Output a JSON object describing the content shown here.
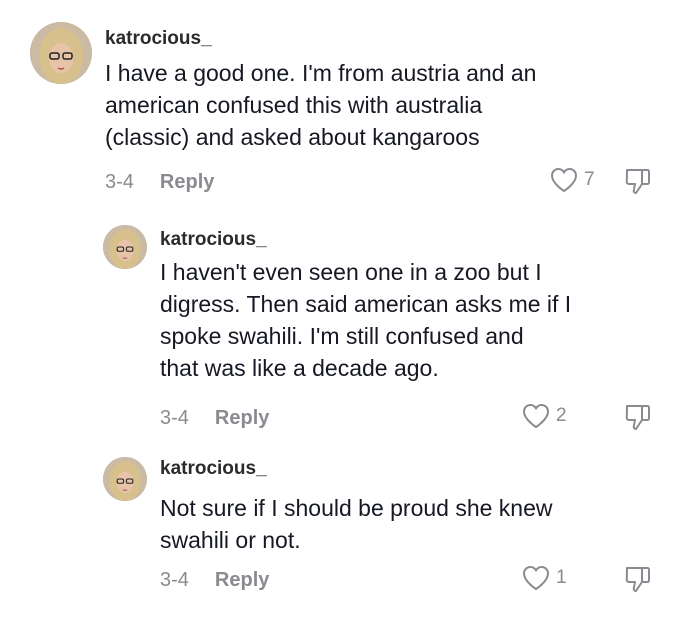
{
  "comments": [
    {
      "username": "katrocious_",
      "lines": [
        "I have a good one. I'm from austria and an",
        "american confused this with australia",
        "(classic) and asked about kangaroos"
      ],
      "date": "3-4",
      "reply_label": "Reply",
      "likes": "7"
    },
    {
      "username": "katrocious_",
      "lines": [
        "I haven't even seen one in a zoo but I",
        "digress. Then said american asks me if I",
        "spoke swahili. I'm still confused and",
        "that was like a decade ago."
      ],
      "date": "3-4",
      "reply_label": "Reply",
      "likes": "2"
    },
    {
      "username": "katrocious_",
      "lines": [
        "Not sure if I should be proud she knew",
        "swahili or not."
      ],
      "date": "3-4",
      "reply_label": "Reply",
      "likes": "1"
    }
  ],
  "icons": {
    "like": "heart-outline-icon",
    "dislike": "thumbs-down-outline-icon"
  },
  "colors": {
    "text": "#161823",
    "muted": "#8a8b91"
  }
}
